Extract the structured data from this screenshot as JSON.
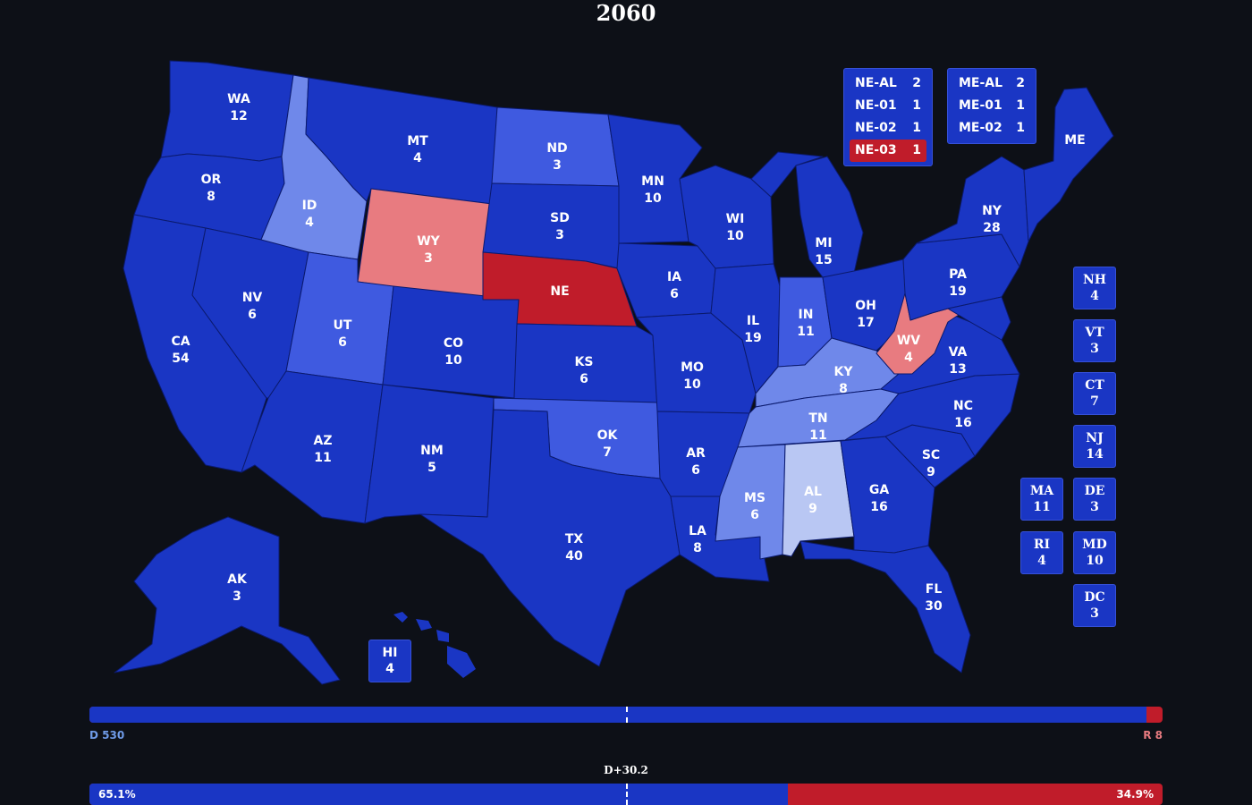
{
  "title": "2060",
  "colors": {
    "safe_d": "#1a36c4",
    "likely_d": "#3f5ae0",
    "lean_d": "#6f88ea",
    "tilt_d": "#b9c7f3",
    "safe_r": "#c01c2a",
    "lean_r": "#e87b80"
  },
  "states": [
    {
      "abbr": "WA",
      "ev": "12"
    },
    {
      "abbr": "OR",
      "ev": "8"
    },
    {
      "abbr": "CA",
      "ev": "54"
    },
    {
      "abbr": "ID",
      "ev": "4"
    },
    {
      "abbr": "NV",
      "ev": "6"
    },
    {
      "abbr": "MT",
      "ev": "4"
    },
    {
      "abbr": "WY",
      "ev": "3"
    },
    {
      "abbr": "UT",
      "ev": "6"
    },
    {
      "abbr": "AZ",
      "ev": "11"
    },
    {
      "abbr": "CO",
      "ev": "10"
    },
    {
      "abbr": "NM",
      "ev": "5"
    },
    {
      "abbr": "ND",
      "ev": "3"
    },
    {
      "abbr": "SD",
      "ev": "3"
    },
    {
      "abbr": "NE",
      "ev": ""
    },
    {
      "abbr": "KS",
      "ev": "6"
    },
    {
      "abbr": "OK",
      "ev": "7"
    },
    {
      "abbr": "TX",
      "ev": "40"
    },
    {
      "abbr": "MN",
      "ev": "10"
    },
    {
      "abbr": "IA",
      "ev": "6"
    },
    {
      "abbr": "MO",
      "ev": "10"
    },
    {
      "abbr": "AR",
      "ev": "6"
    },
    {
      "abbr": "LA",
      "ev": "8"
    },
    {
      "abbr": "WI",
      "ev": "10"
    },
    {
      "abbr": "IL",
      "ev": "19"
    },
    {
      "abbr": "MI",
      "ev": "15"
    },
    {
      "abbr": "IN",
      "ev": "11"
    },
    {
      "abbr": "OH",
      "ev": "17"
    },
    {
      "abbr": "KY",
      "ev": "8"
    },
    {
      "abbr": "TN",
      "ev": "11"
    },
    {
      "abbr": "MS",
      "ev": "6"
    },
    {
      "abbr": "AL",
      "ev": "9"
    },
    {
      "abbr": "GA",
      "ev": "16"
    },
    {
      "abbr": "FL",
      "ev": "30"
    },
    {
      "abbr": "SC",
      "ev": "9"
    },
    {
      "abbr": "NC",
      "ev": "16"
    },
    {
      "abbr": "VA",
      "ev": "13"
    },
    {
      "abbr": "WV",
      "ev": "4"
    },
    {
      "abbr": "PA",
      "ev": "19"
    },
    {
      "abbr": "NY",
      "ev": "28"
    },
    {
      "abbr": "ME",
      "ev": ""
    },
    {
      "abbr": "AK",
      "ev": "3"
    }
  ],
  "hawaii": {
    "abbr": "HI",
    "ev": "4"
  },
  "districts_ne": [
    {
      "label": "NE-AL",
      "ev": "2",
      "party": "D"
    },
    {
      "label": "NE-01",
      "ev": "1",
      "party": "D"
    },
    {
      "label": "NE-02",
      "ev": "1",
      "party": "D"
    },
    {
      "label": "NE-03",
      "ev": "1",
      "party": "R"
    }
  ],
  "districts_me": [
    {
      "label": "ME-AL",
      "ev": "2",
      "party": "D"
    },
    {
      "label": "ME-01",
      "ev": "1",
      "party": "D"
    },
    {
      "label": "ME-02",
      "ev": "1",
      "party": "D"
    }
  ],
  "small_states": [
    {
      "abbr": "NH",
      "ev": "4"
    },
    {
      "abbr": "VT",
      "ev": "3"
    },
    {
      "abbr": "CT",
      "ev": "7"
    },
    {
      "abbr": "NJ",
      "ev": "14"
    },
    {
      "abbr": "MA",
      "ev": "11"
    },
    {
      "abbr": "DE",
      "ev": "3"
    },
    {
      "abbr": "RI",
      "ev": "4"
    },
    {
      "abbr": "MD",
      "ev": "10"
    },
    {
      "abbr": "DC",
      "ev": "3"
    }
  ],
  "ev_bar": {
    "d_label": "D 530",
    "r_label": "R 8",
    "d_share": 0.985
  },
  "pv_bar": {
    "margin_label": "D+30.2",
    "d_label": "65.1%",
    "r_label": "34.9%",
    "d_share": 0.651
  }
}
